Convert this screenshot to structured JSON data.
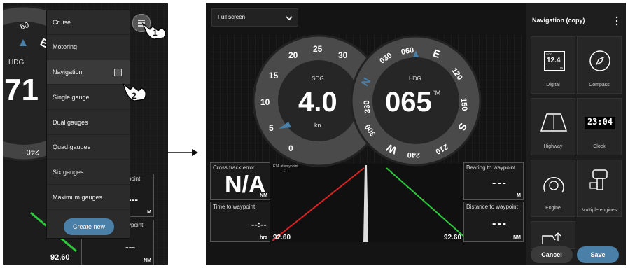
{
  "left": {
    "hdg_label": "HDG",
    "hdg_digits": "71",
    "menu_items": [
      "Cruise",
      "Motoring",
      "Navigation",
      "Single gauge",
      "Dual gauges",
      "Quad gauges",
      "Six gauges",
      "Maximum gauges"
    ],
    "create_new": "Create new",
    "speed_value": "92.60",
    "bg_box1_title": "point",
    "bg_box1_unit": "M",
    "bg_box2_title": "ypoint",
    "bg_box2_unit": "NM",
    "step1": "1",
    "step2": "2"
  },
  "right": {
    "view_select": "Full screen",
    "sog_label": "SOG",
    "sog_value": "4.0",
    "sog_unit": "kn",
    "hdg_label": "HDG",
    "hdg_value": "065",
    "hdg_unit": "°M",
    "xte": {
      "title": "Cross track error",
      "value": "N/A",
      "unit": "NM"
    },
    "ttw": {
      "title": "Time to waypoint",
      "value": "--:--",
      "unit": "hrs"
    },
    "btw": {
      "title": "Bearing to waypoint",
      "value": "---",
      "unit": "M"
    },
    "dtw": {
      "title": "Distance to waypoint",
      "value": "---",
      "unit": "NM"
    },
    "waypoint_label": "ETA at waypoint",
    "waypoint_value": "--:--",
    "left_speed": "92.60",
    "right_speed": "92.60"
  },
  "sidebar": {
    "title": "Navigation (copy)",
    "digital_icon_top": "SOG",
    "digital_icon_value": "12.4",
    "digital_icon_unit": "KN",
    "clock_icon_value": "23:04",
    "tiles": [
      "Digital",
      "Compass",
      "Highway",
      "Clock",
      "Engine",
      "Multiple engines"
    ],
    "cancel": "Cancel",
    "save": "Save"
  },
  "colors": {
    "accent": "#4a7fa8",
    "red_line": "#d22",
    "green_line": "#2ec83c",
    "bg": "#111111"
  }
}
